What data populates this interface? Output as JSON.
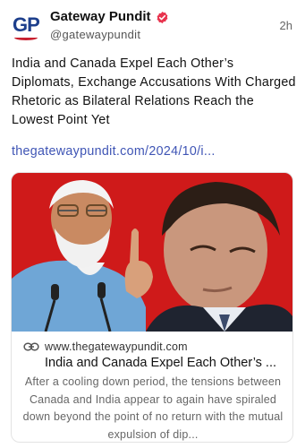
{
  "post": {
    "avatar_text": "GP",
    "display_name": "Gateway Pundit",
    "handle": "@gatewaypundit",
    "time": "2h",
    "body": "India and Canada Expel Each Other’s Diplomats, Exchange Accusations With Charged Rhetoric as Bilateral Relations Reach the Lowest Point Yet",
    "link": "thegatewaypundit.com/2024/10/i..."
  },
  "card": {
    "domain": "www.thegatewaypundit.com",
    "title": "India and Canada Expel Each Other’s ...",
    "description": "After a cooling down period, the tensions between Canada and India appear to again have spiraled down beyond the point of no return with the mutual expulsion of dip..."
  },
  "icons": {
    "verified": "verified-badge-icon",
    "link": "link-chain-icon"
  },
  "colors": {
    "brand_blue": "#1d3f8c",
    "brand_red": "#c8202f",
    "link": "#3f55b5",
    "verified": "#e8344e",
    "image_background": "#d81e1e"
  }
}
